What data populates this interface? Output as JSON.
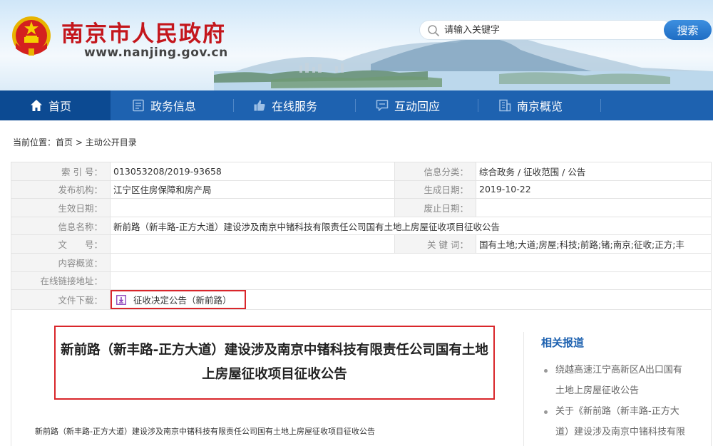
{
  "header": {
    "site_title": "南京市人民政府",
    "site_url": "www.nanjing.gov.cn",
    "search_placeholder": "请输入关键字",
    "search_button": "搜索"
  },
  "nav": {
    "items": [
      {
        "label": "首页",
        "icon": "home-icon",
        "active": true
      },
      {
        "label": "政务信息",
        "icon": "document-icon"
      },
      {
        "label": "在线服务",
        "icon": "thumbs-up-icon"
      },
      {
        "label": "互动回应",
        "icon": "chat-icon"
      },
      {
        "label": "南京概览",
        "icon": "building-icon"
      }
    ]
  },
  "breadcrumb": {
    "prefix": "当前位置：",
    "home": "首页",
    "separator": " > ",
    "current": "主动公开目录"
  },
  "info": {
    "index_label": "索 引 号：",
    "index_value": "013053208/2019-93658",
    "category_label": "信息分类：",
    "category_value": "综合政务 / 征收范围 / 公告",
    "publisher_label": "发布机构：",
    "publisher_value": "江宁区住房保障和房产局",
    "created_label": "生成日期：",
    "created_value": "2019-10-22",
    "effective_label": "生效日期：",
    "effective_value": "",
    "expired_label": "废止日期：",
    "expired_value": "",
    "name_label": "信息名称：",
    "name_value": "新前路（新丰路-正方大道）建设涉及南京中锗科技有限责任公司国有土地上房屋征收项目征收公告",
    "docno_label": "文　　号：",
    "docno_value": "",
    "keywords_label": "关 键 词：",
    "keywords_value": "国有土地;大道;房屋;科技;前路;锗;南京;征收;正方;丰",
    "summary_label": "内容概览：",
    "summary_value": "",
    "link_label": "在线链接地址：",
    "link_value": "",
    "download_label": "文件下载：",
    "download_file": "征收决定公告（新前路）"
  },
  "article": {
    "title_line1": "新前路（新丰路-正方大道）建设涉及南京中锗科技有限责任公司国有土地",
    "title_line2": "上房屋征收项目征收公告",
    "text": "新前路（新丰路-正方大道）建设涉及南京中锗科技有限责任公司国有土地上房屋征收项目征收公告"
  },
  "related": {
    "title": "相关报道",
    "items": [
      {
        "line1": "绕越高速江宁高新区A出口国有",
        "line2": "土地上房屋征收公告"
      },
      {
        "line1": "关于《新前路（新丰路-正方大",
        "line2": "道）建设涉及南京中锗科技有限"
      }
    ]
  },
  "colors": {
    "brand_red": "#c4161c",
    "nav_blue": "#1e62b0",
    "nav_active": "#0c4a92",
    "highlight_red": "#d9262b"
  }
}
